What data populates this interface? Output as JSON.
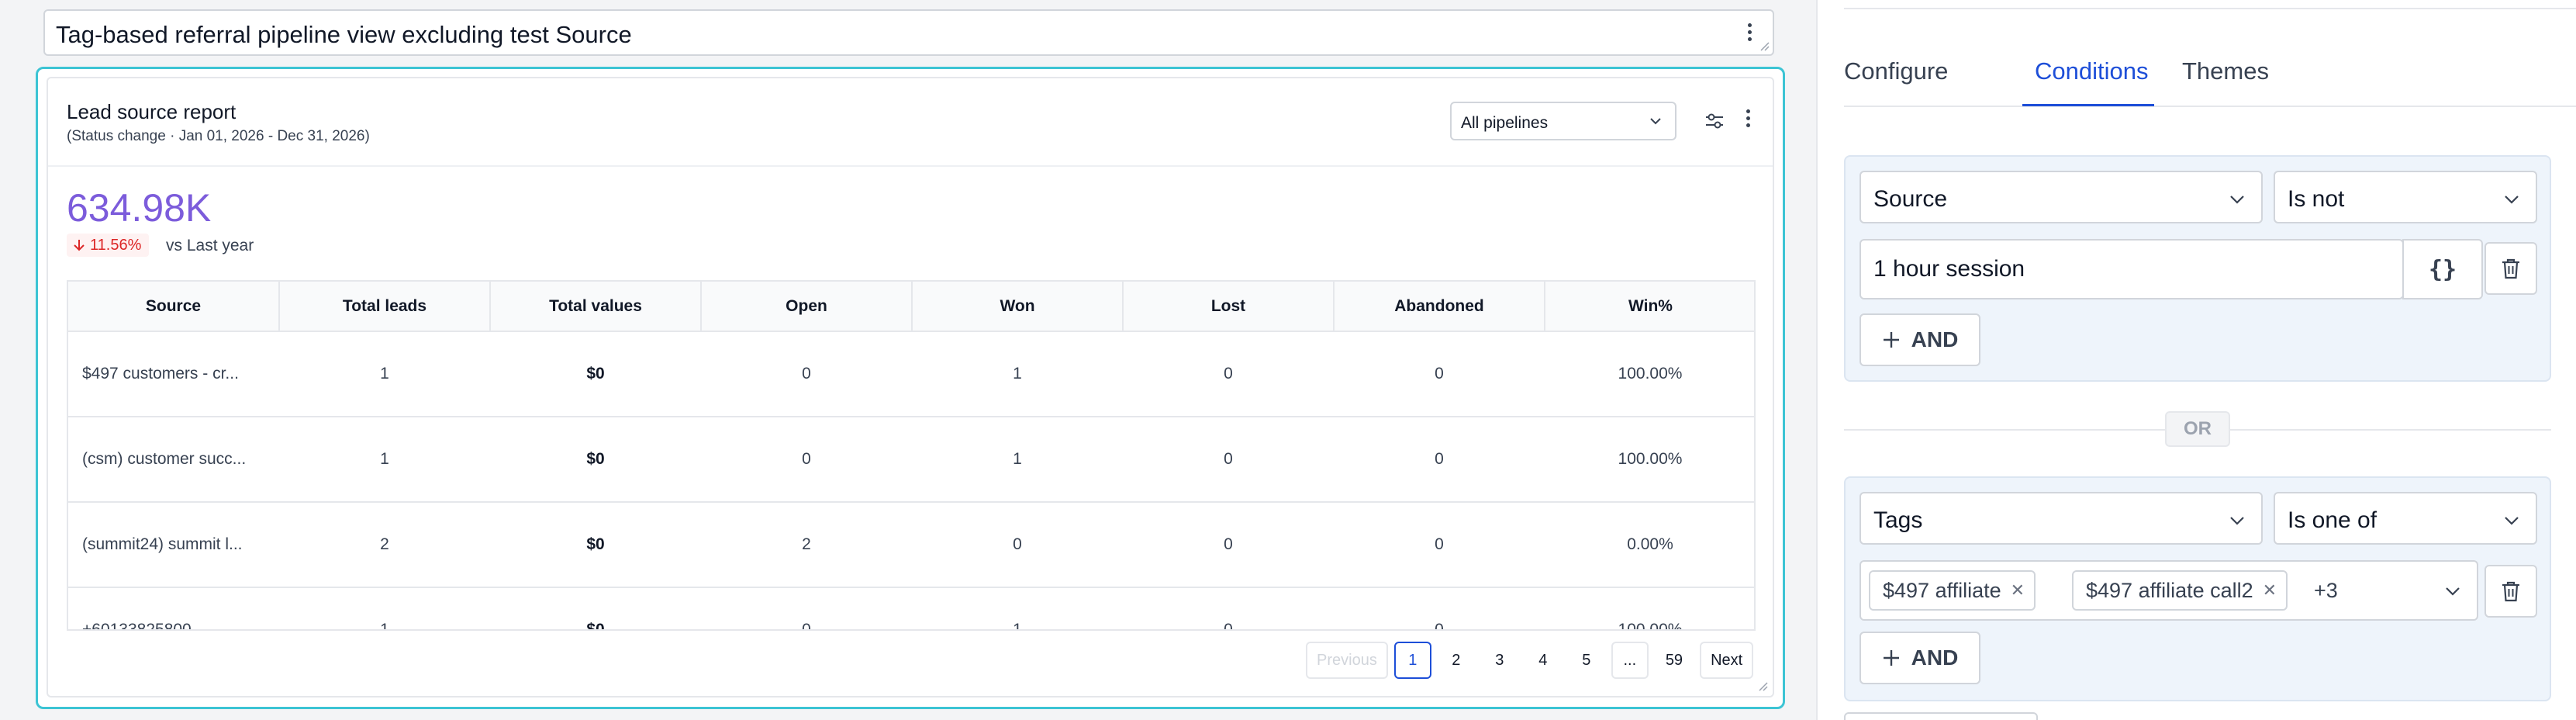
{
  "report_title": "Tag-based referral pipeline view excluding test Source",
  "widget": {
    "title": "Lead source report",
    "subtitle": "(Status change · Jan 01, 2026 - Dec 31, 2026)",
    "pipeline_select": "All pipelines",
    "kpi_value": "634.98K",
    "delta_value": "11.56%",
    "delta_direction": "down",
    "comparison_label": "vs Last year",
    "table": {
      "columns": [
        "Source",
        "Total leads",
        "Total values",
        "Open",
        "Won",
        "Lost",
        "Abandoned",
        "Win%"
      ],
      "rows": [
        [
          "$497 customers - cr...",
          "1",
          "$0",
          "0",
          "1",
          "0",
          "0",
          "100.00%"
        ],
        [
          "(csm) customer succ...",
          "1",
          "$0",
          "0",
          "1",
          "0",
          "0",
          "100.00%"
        ],
        [
          "(summit24) summit l...",
          "2",
          "$0",
          "2",
          "0",
          "0",
          "0",
          "0.00%"
        ],
        [
          "+60133825800",
          "1",
          "$0",
          "0",
          "1",
          "0",
          "0",
          "100.00%"
        ]
      ]
    },
    "pagination": {
      "previous": "Previous",
      "pages": [
        "1",
        "2",
        "3",
        "4",
        "5"
      ],
      "ellipsis": "...",
      "last": "59",
      "next": "Next",
      "current": "1"
    }
  },
  "panel": {
    "tabs": [
      "Configure",
      "Conditions",
      "Themes"
    ],
    "active_tab": "Conditions",
    "group1": {
      "field": "Source",
      "operator": "Is not",
      "value": "1 hour session",
      "braces": "{}",
      "and_label": "AND"
    },
    "or_label": "OR",
    "group2": {
      "field": "Tags",
      "operator": "Is one of",
      "chips": [
        "$497 affiliate",
        "$497 affiliate call2"
      ],
      "more": "+3",
      "and_label": "AND"
    }
  },
  "colors": {
    "accent": "#1d4ed8",
    "kpi": "#7c5cdb",
    "selection_outline": "#3cc4d4",
    "negative": "#dc2626"
  },
  "icons": [
    "kebab-icon",
    "chevron-down-icon",
    "filter-settings-icon",
    "arrow-down-icon",
    "trash-icon",
    "plus-icon",
    "close-icon",
    "resize-grip-icon"
  ]
}
